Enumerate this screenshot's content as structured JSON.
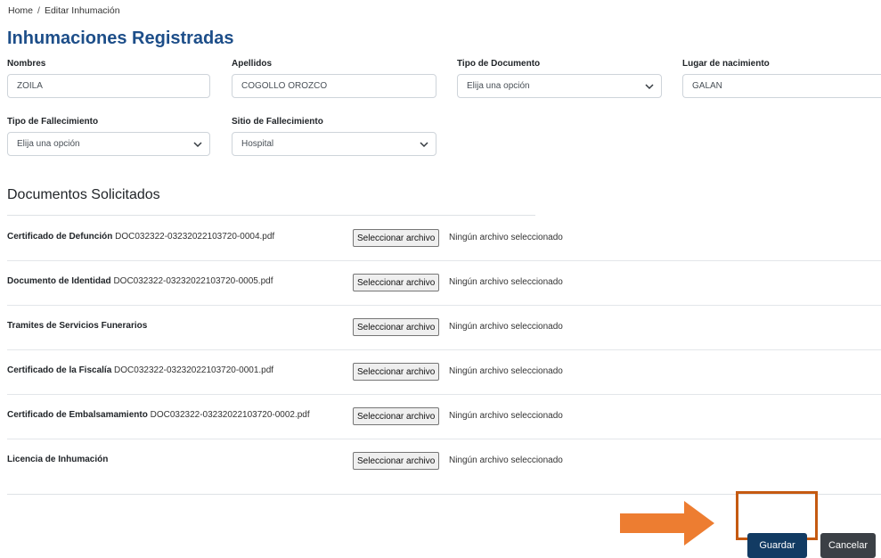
{
  "breadcrumb": {
    "home": "Home",
    "separator": "/",
    "current": "Editar Inhumación"
  },
  "page_title": "Inhumaciones Registradas",
  "form": {
    "nombres": {
      "label": "Nombres",
      "value": "ZOILA"
    },
    "apellidos": {
      "label": "Apellidos",
      "value": "COGOLLO OROZCO"
    },
    "tipo_documento": {
      "label": "Tipo de Documento",
      "value": "Elija una opción"
    },
    "lugar_nacimiento": {
      "label": "Lugar de nacimiento",
      "value": "GALAN"
    },
    "tipo_fallecimiento": {
      "label": "Tipo de Fallecimiento",
      "value": "Elija una opción"
    },
    "sitio_fallecimiento": {
      "label": "Sitio de Fallecimiento",
      "value": "Hospital"
    }
  },
  "documents": {
    "title": "Documentos Solicitados",
    "button_label": "Seleccionar archivo",
    "no_file_label": "Ningún archivo seleccionado",
    "items": [
      {
        "label": "Certificado de Defunción",
        "filename": "DOC032322-03232022103720-0004.pdf"
      },
      {
        "label": "Documento de Identidad",
        "filename": "DOC032322-03232022103720-0005.pdf"
      },
      {
        "label": "Tramites de Servicios Funerarios",
        "filename": ""
      },
      {
        "label": "Certificado de la Fiscalía",
        "filename": "DOC032322-03232022103720-0001.pdf"
      },
      {
        "label": "Certificado de Embalsamamiento",
        "filename": "DOC032322-03232022103720-0002.pdf"
      },
      {
        "label": "Licencia de Inhumación",
        "filename": ""
      }
    ]
  },
  "actions": {
    "save": "Guardar",
    "cancel": "Cancelar"
  },
  "colors": {
    "title": "#1d4e89",
    "save_button": "#123b63",
    "cancel_button": "#3b4046",
    "annotation": "#c55a11",
    "arrow": "#ed7d31"
  }
}
